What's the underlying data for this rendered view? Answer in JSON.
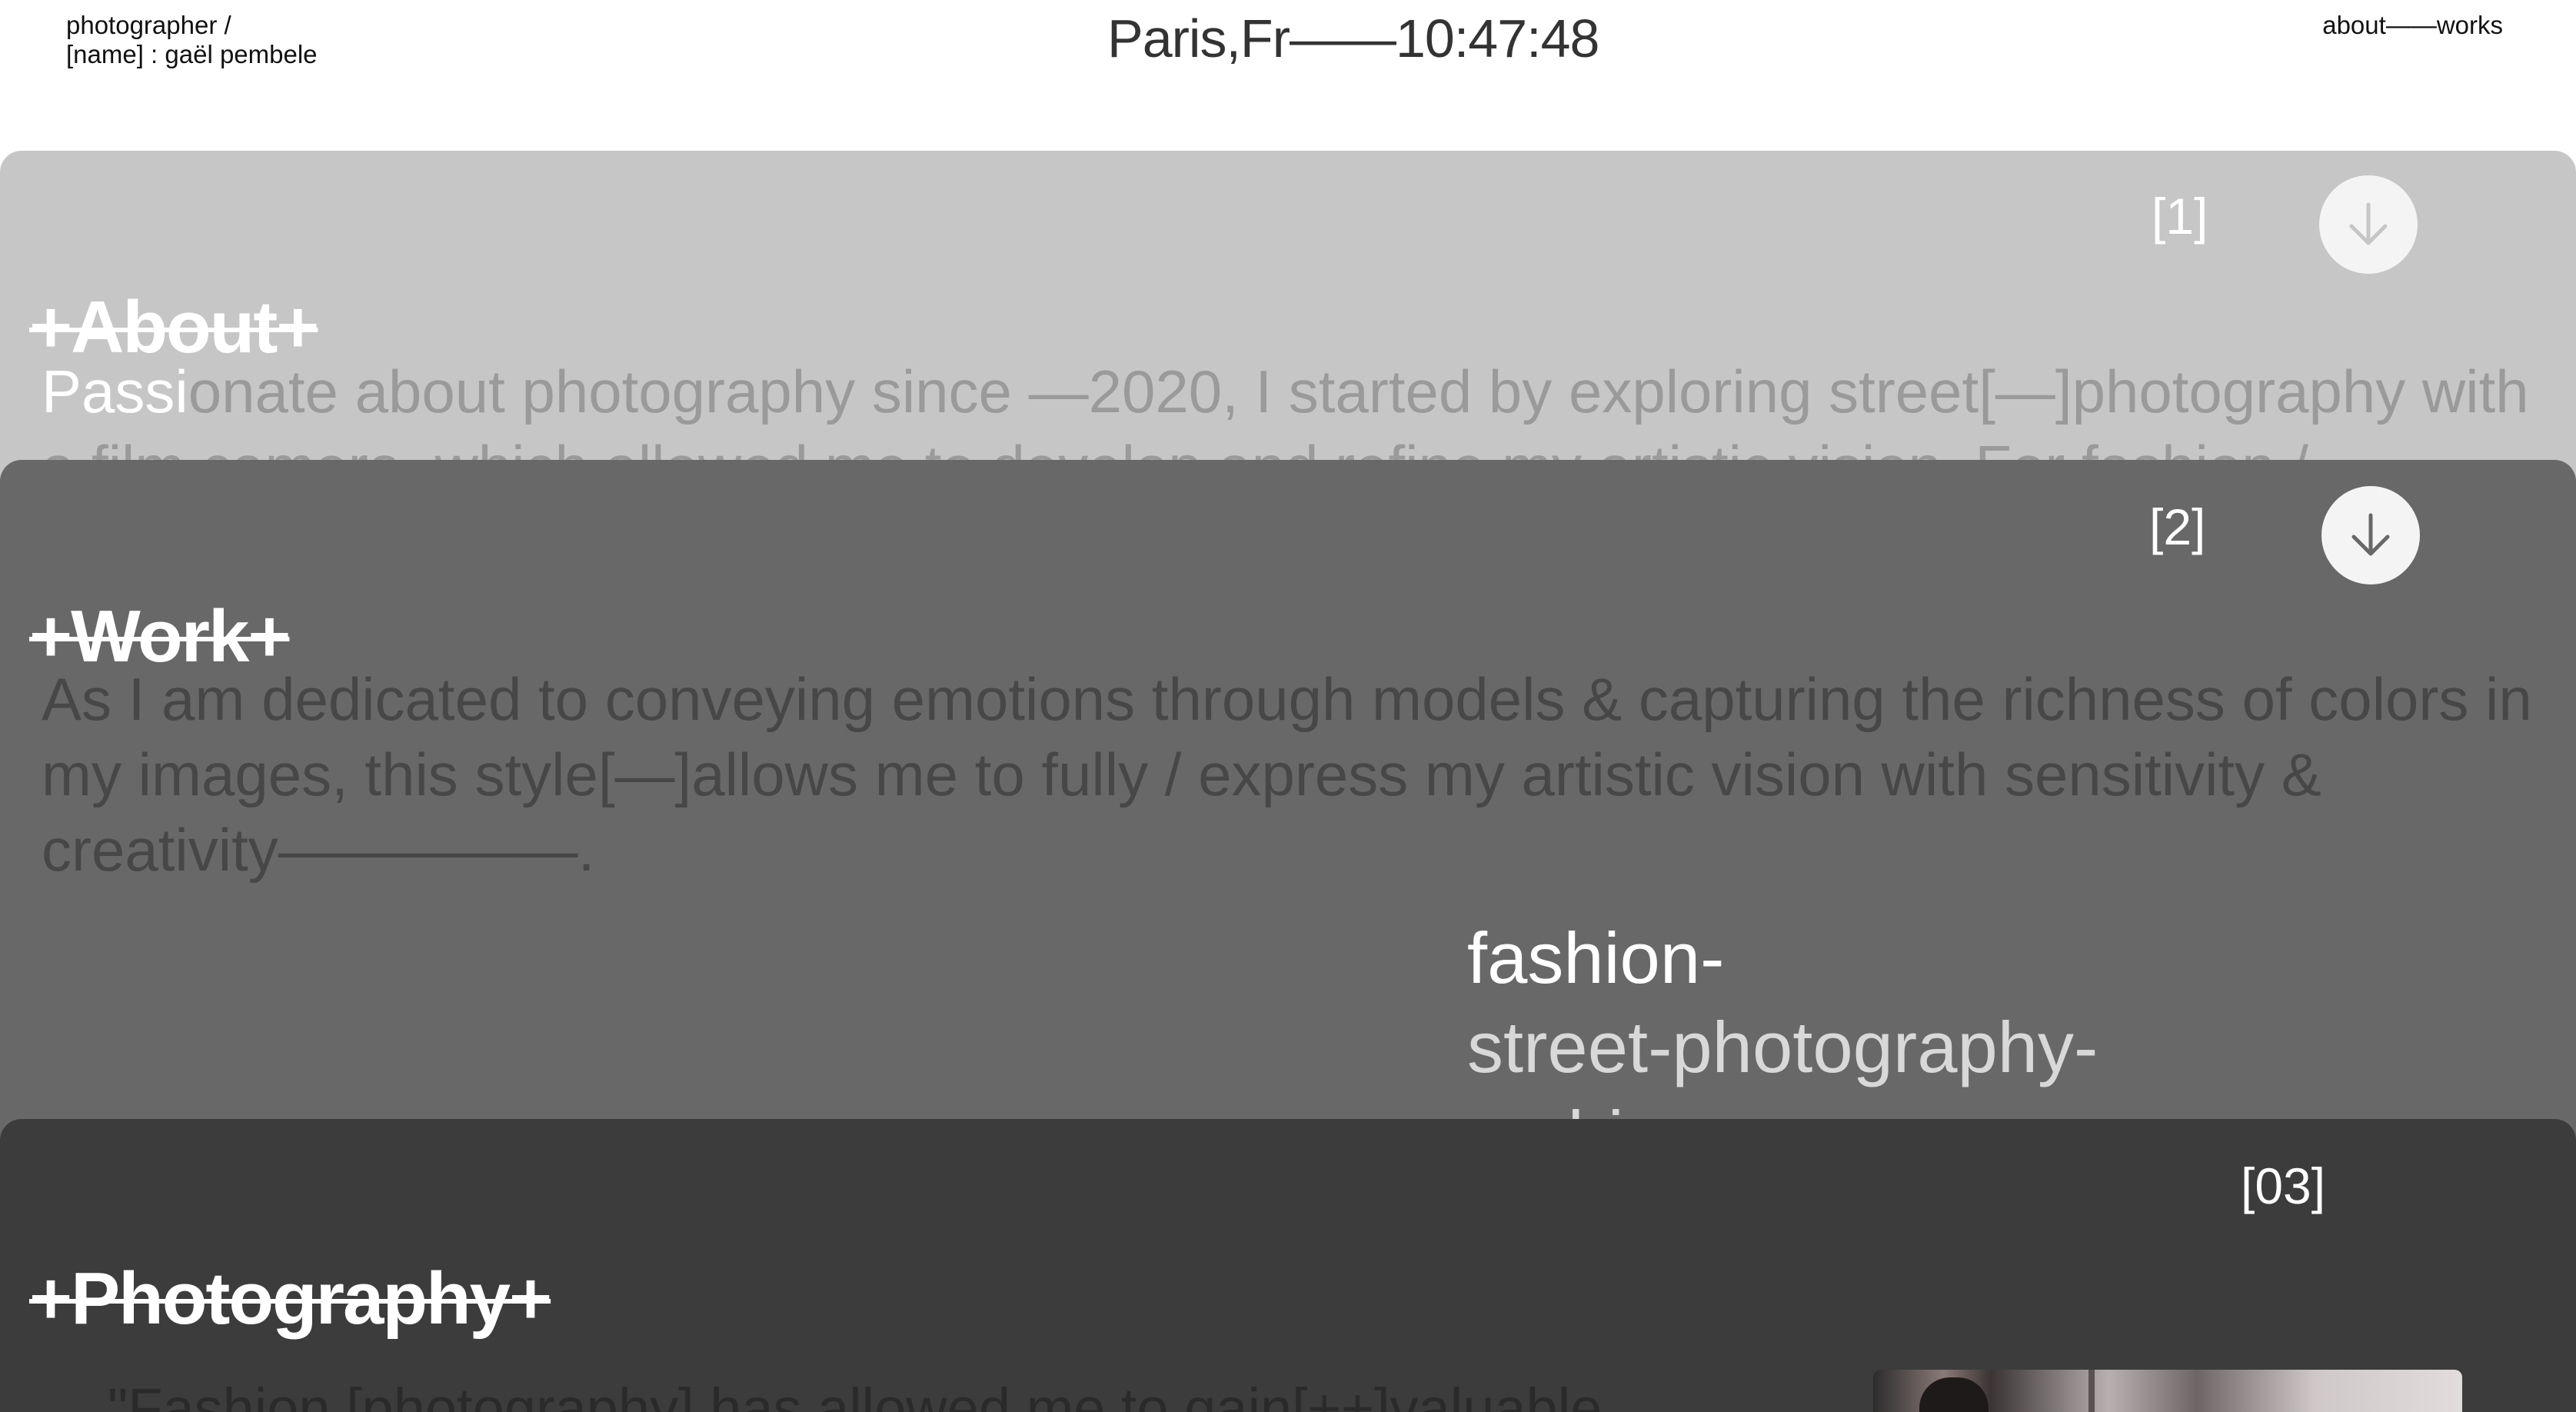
{
  "header": {
    "role_line": "photographer /",
    "name_line": "[name] : gaël pembele",
    "clock": "Paris,Fr——10:47:48",
    "nav": {
      "about": "about",
      "separator": "——",
      "works": "works"
    }
  },
  "sections": {
    "about": {
      "title": "+About+",
      "index": "[1]",
      "text_lead": "Passi",
      "text_rest": "onate about photography since —2020, I started by exploring street[—]photography with a film camera, which allowed me to develop and refine my artistic vision. For fashion /"
    },
    "work": {
      "title": "+Work+",
      "index": "[2]",
      "text": "As I am dedicated to conveying emotions through models & capturing the richness of colors in my images, this style[—]allows me to fully / express my artistic vision with sensitivity & creativity—————.",
      "tags": [
        "fashion-",
        "street-photography-",
        "archive"
      ]
    },
    "photography": {
      "title": "+Photography+",
      "index": "[03]",
      "quote": "\"Fashion [photography] has allowed me to gain[++]valuable"
    }
  },
  "colors": {
    "panel_about": "#c6c6c6",
    "panel_work": "#686868",
    "panel_photo": "#3c3c3c"
  },
  "icons": {
    "panel_arrow": "arrow-down-icon"
  }
}
